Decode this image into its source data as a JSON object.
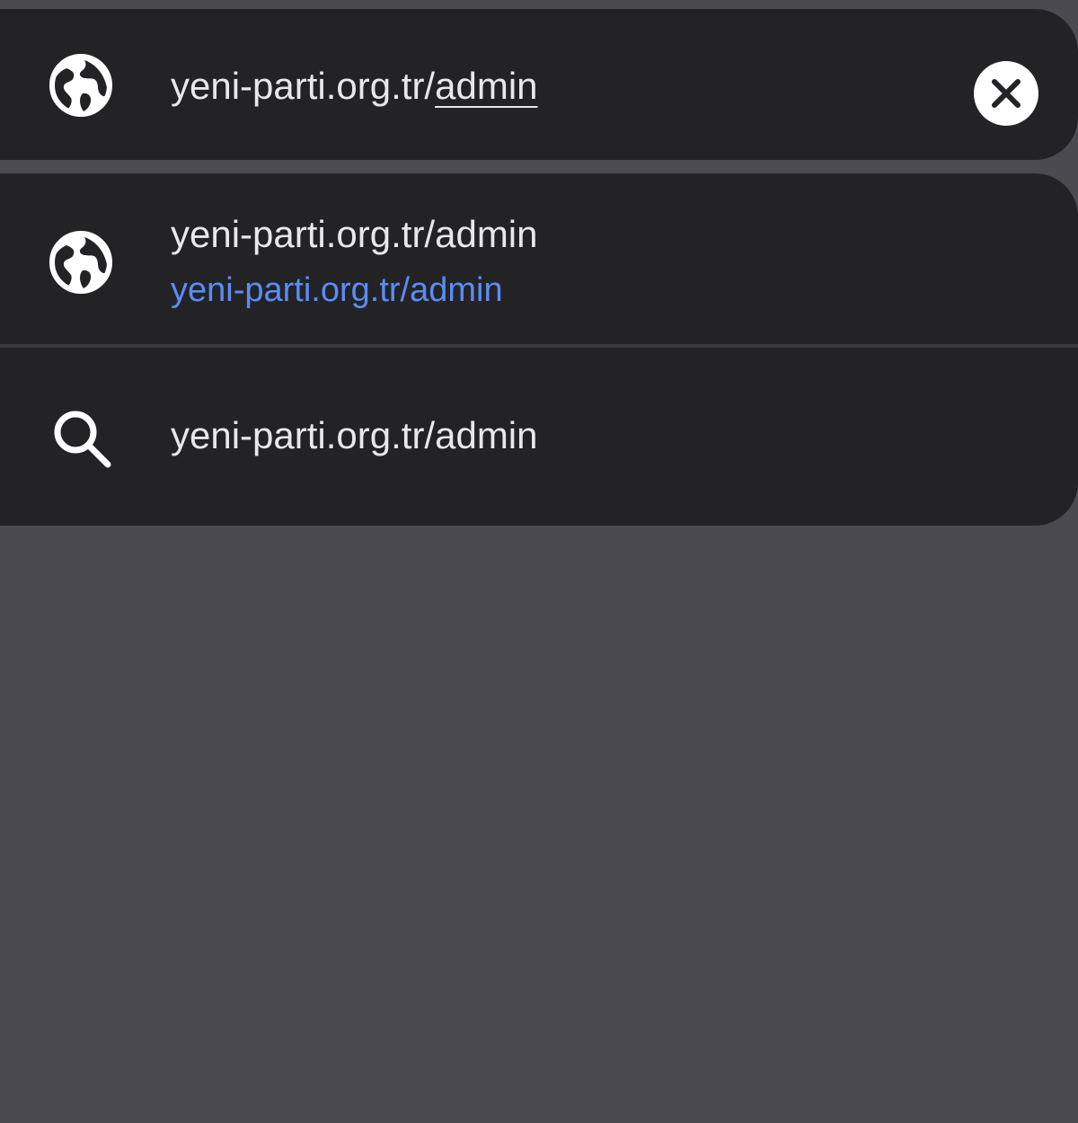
{
  "omnibox": {
    "typed_text": "yeni-parti.org.tr/",
    "autocomplete_text": "admin",
    "globe_icon": "globe-icon",
    "clear_icon": "clear-icon"
  },
  "suggestions": [
    {
      "icon": "globe-icon",
      "title": "yeni-parti.org.tr/admin",
      "url": "yeni-parti.org.tr/admin"
    },
    {
      "icon": "search-icon",
      "title": "yeni-parti.org.tr/admin"
    }
  ],
  "colors": {
    "background": "#4b4a4f",
    "surface": "#232326",
    "text": "#e8e8ea",
    "link": "#5b8cf6"
  }
}
